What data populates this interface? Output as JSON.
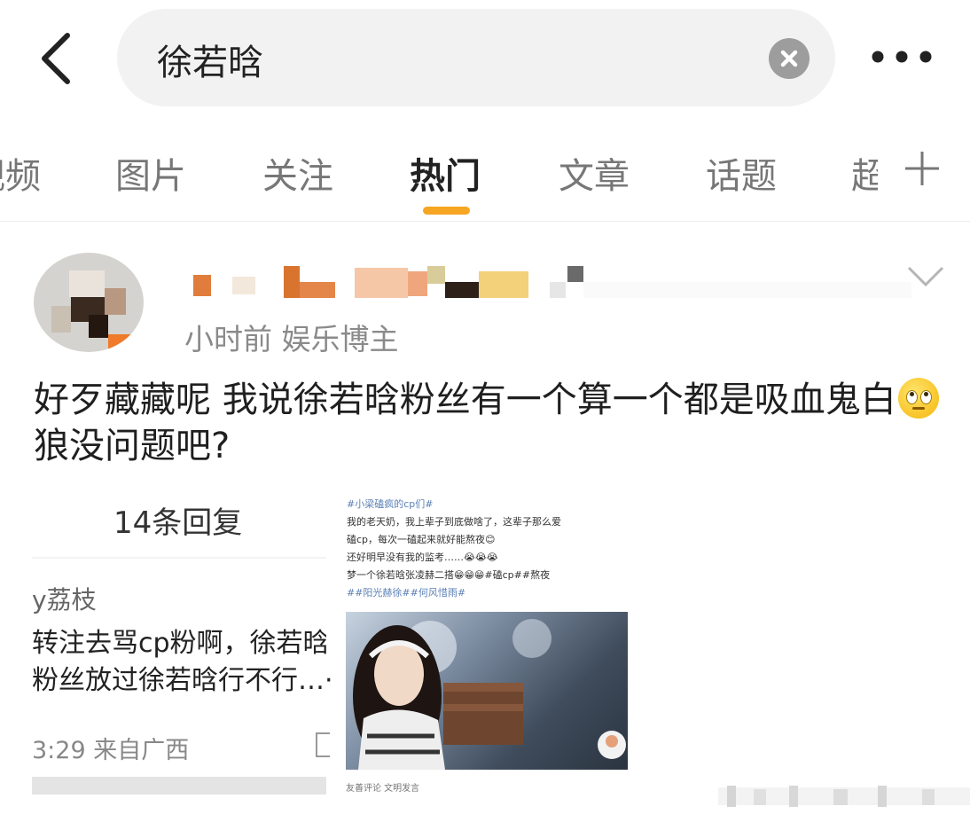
{
  "header": {
    "back_icon": "chevron-left-icon",
    "search_query": "徐若晗",
    "clear_icon": "close-circle-icon",
    "more_icon": "more-horizontal-icon"
  },
  "tabs": [
    {
      "label": "视频"
    },
    {
      "label": "图片"
    },
    {
      "label": "关注"
    },
    {
      "label": "热门",
      "active": true
    },
    {
      "label": "文章"
    },
    {
      "label": "话题"
    },
    {
      "label": "超"
    }
  ],
  "tab_add_icon": "plus-icon",
  "colors": {
    "accent": "#f6a623",
    "text": "#222222",
    "muted": "#8a8a8a"
  },
  "post": {
    "meta": "小时前  娱乐博主",
    "expand_icon": "chevron-down-icon",
    "text_part1": "好歹藏藏呢 我说徐若晗粉丝有一个算一个都是吸血鬼白",
    "emoji": "eye-roll-emoji",
    "text_part2": "狼没问题吧?"
  },
  "reply_card": {
    "reply_count": "14条回复",
    "commenter": "y荔枝",
    "line1": "转注去骂cp粉啊，徐若晗",
    "line2": "粉丝放过徐若晗行不行…·",
    "meta": "3:29 来自广西"
  },
  "screenshot": {
    "lines": [
      "#小梁磕疯的cp们#",
      "我的老天奶，我上辈子到底做啥了，这辈子那么爱",
      "磕cp，每次一磕起来就好能熬夜😊",
      "还好明早没有我的监考……😭😭😭",
      "梦一个徐若晗张凌赫二搭😁😁😁#磕cp##熬夜",
      "##阳光赫徐##何风惜雨#"
    ],
    "footer": "友善评论  文明发言"
  }
}
